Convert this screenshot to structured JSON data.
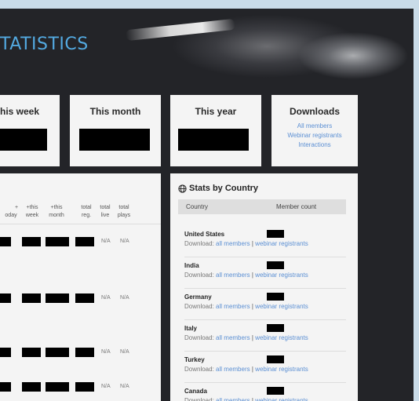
{
  "page": {
    "title": "TATISTICS"
  },
  "summary_cards": {
    "week": {
      "title": "his week"
    },
    "month": {
      "title": "This month"
    },
    "year": {
      "title": "This year"
    }
  },
  "downloads": {
    "title": "Downloads",
    "links": [
      "All members",
      "Webinar registrants",
      "Interactions"
    ]
  },
  "table": {
    "columns": [
      {
        "line1": "+",
        "line2": "oday"
      },
      {
        "line1": "+this",
        "line2": "week"
      },
      {
        "line1": "+this",
        "line2": "month"
      },
      {
        "line1": "total",
        "line2": "reg."
      },
      {
        "line1": "total",
        "line2": "live"
      },
      {
        "line1": "total",
        "line2": "plays"
      }
    ],
    "rows": [
      {
        "live": "N/A",
        "plays": "N/A"
      },
      {
        "live": "N/A",
        "plays": "N/A"
      },
      {
        "live": "N/A",
        "plays": "N/A"
      },
      {
        "live": "N/A",
        "plays": "N/A"
      }
    ]
  },
  "country_stats": {
    "title": "Stats by Country",
    "col_country": "Country",
    "col_count": "Member count",
    "download_prefix": "Download:",
    "all_members": "all members",
    "separator": "|",
    "webinar": "webinar registrants",
    "countries": [
      {
        "name": "United States"
      },
      {
        "name": "India"
      },
      {
        "name": "Germany"
      },
      {
        "name": "Italy"
      },
      {
        "name": "Turkey"
      },
      {
        "name": "Canada"
      }
    ]
  },
  "colors": {
    "background": "#232428",
    "accent": "#53a9e0",
    "link": "#5b8fd3"
  }
}
